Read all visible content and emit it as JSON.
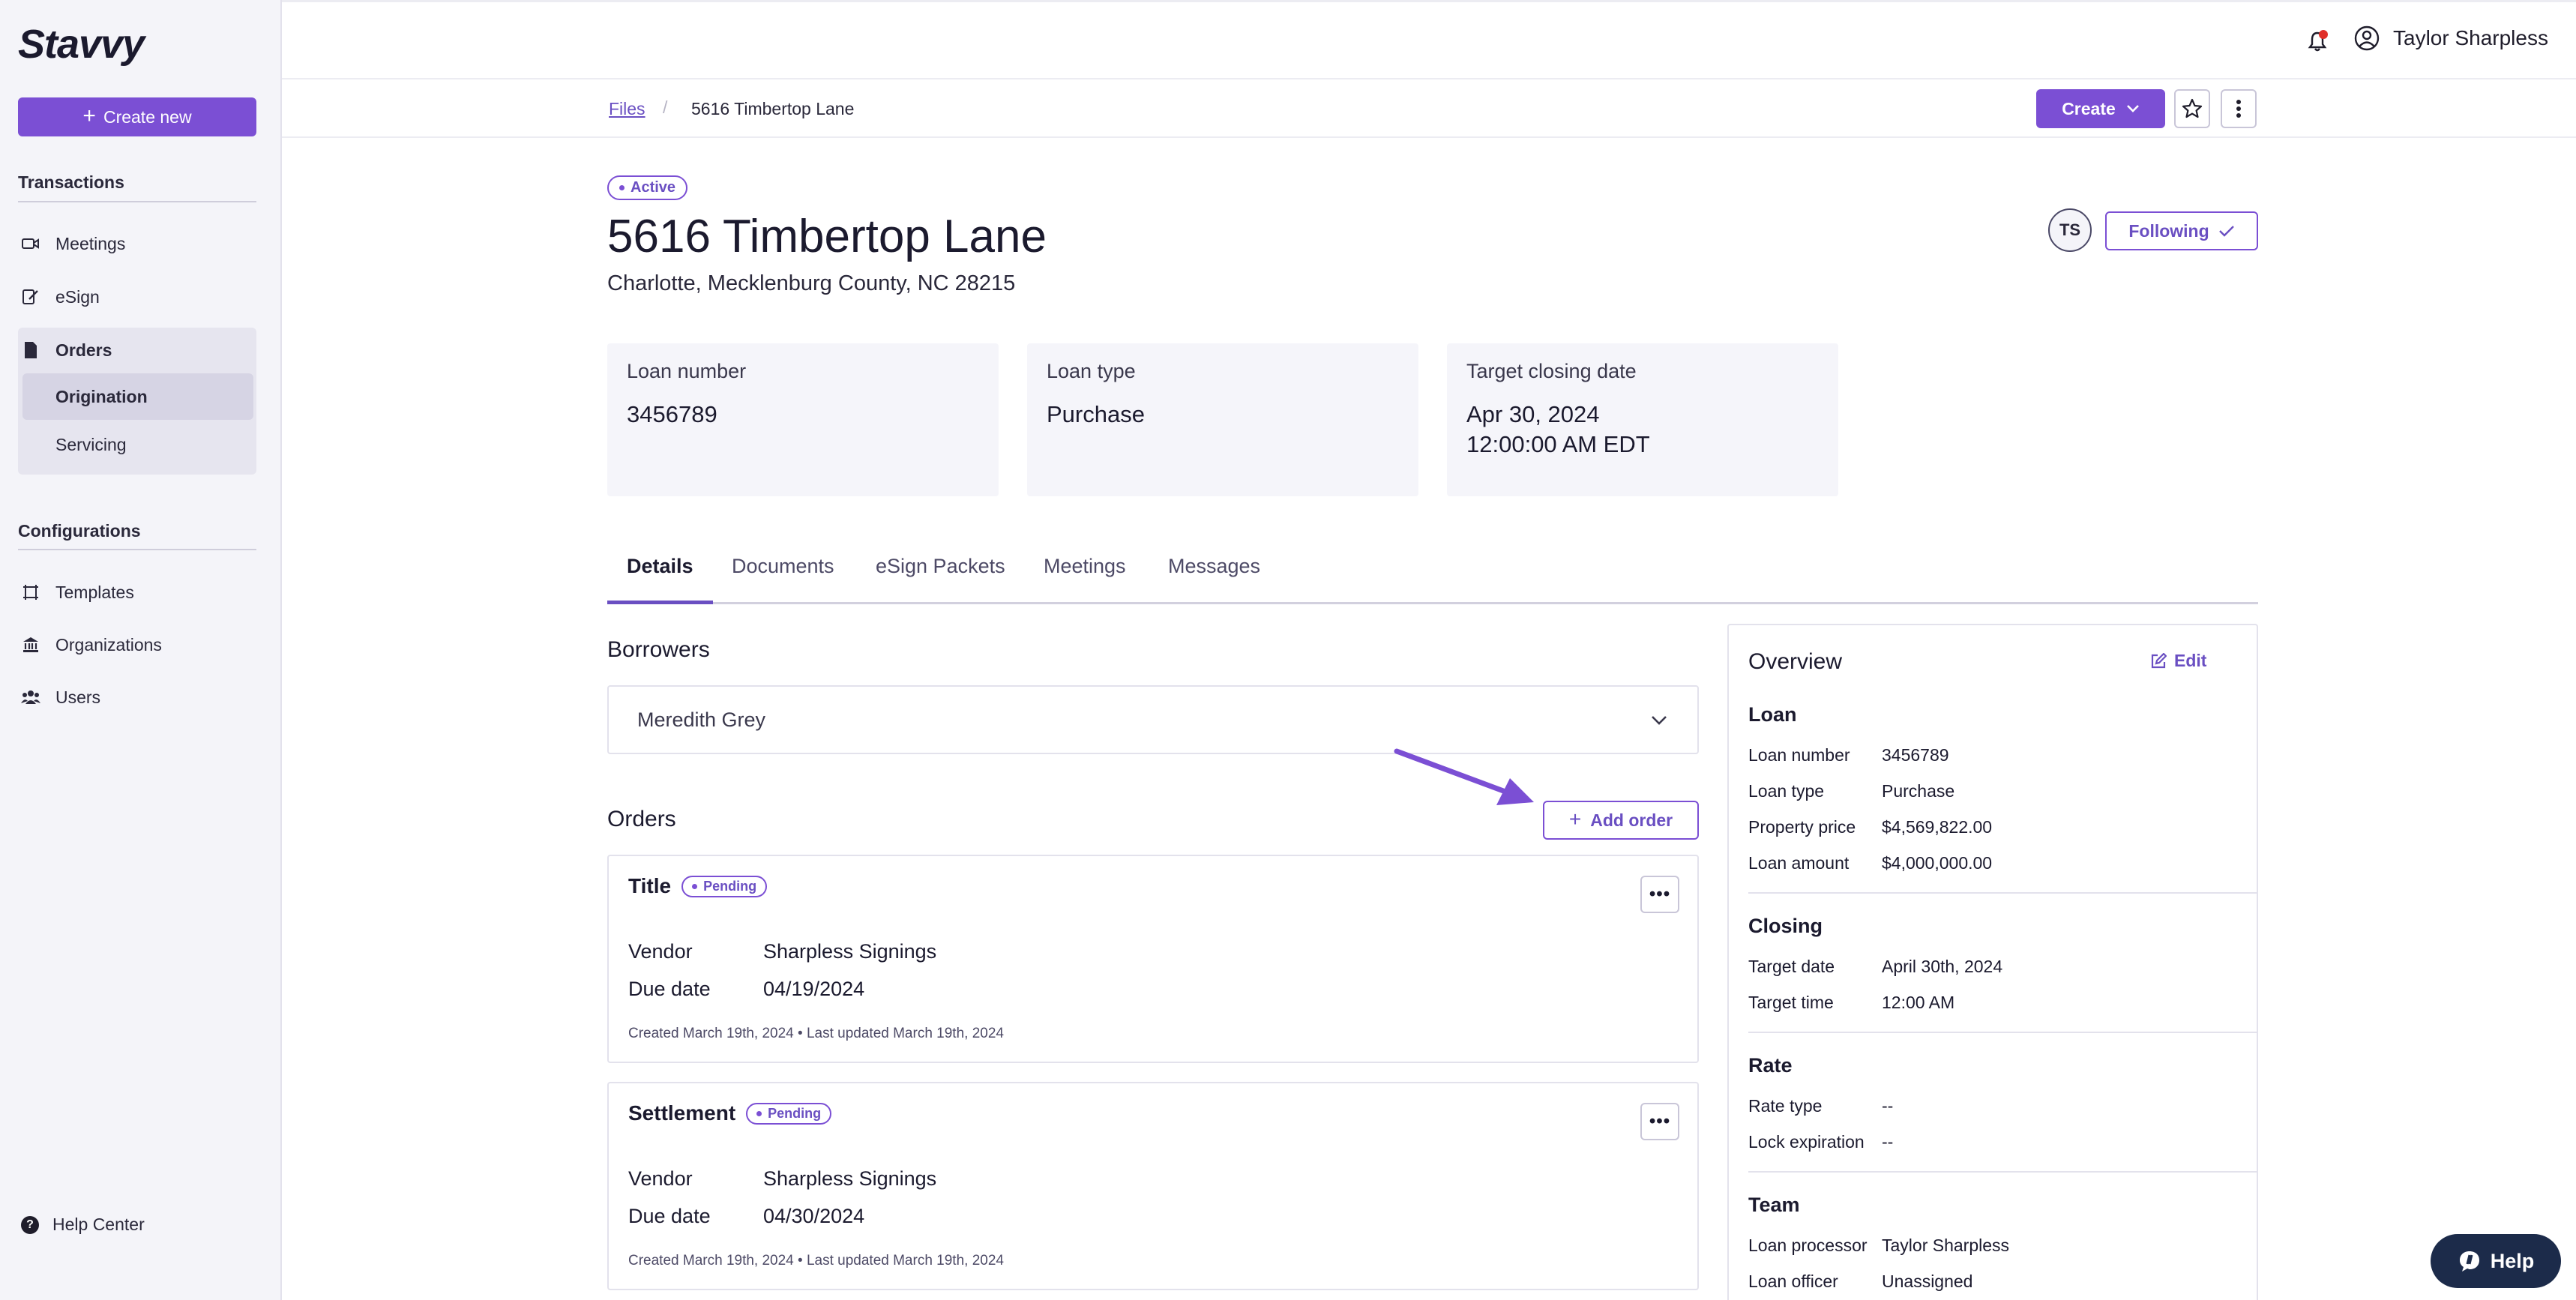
{
  "app": {
    "logo": "Stavvy"
  },
  "sidebar": {
    "create_new_label": "Create new",
    "transactions_title": "Transactions",
    "transactions": [
      {
        "label": "Meetings",
        "icon": "video-icon"
      },
      {
        "label": "eSign",
        "icon": "signature-icon"
      },
      {
        "label": "Orders",
        "icon": "document-icon"
      }
    ],
    "orders_sub": [
      {
        "label": "Origination",
        "active": true
      },
      {
        "label": "Servicing",
        "active": false
      }
    ],
    "configurations_title": "Configurations",
    "configurations": [
      {
        "label": "Templates",
        "icon": "template-icon"
      },
      {
        "label": "Organizations",
        "icon": "bank-icon"
      },
      {
        "label": "Users",
        "icon": "users-icon"
      }
    ],
    "help_center_label": "Help Center"
  },
  "header": {
    "user_name": "Taylor Sharpless",
    "notification_dot_color": "#e0302a"
  },
  "breadcrumb": {
    "root": "Files",
    "separator": "/",
    "current": "5616 Timbertop Lane"
  },
  "actions": {
    "create_label": "Create"
  },
  "file": {
    "status": "Active",
    "title": "5616 Timbertop Lane",
    "address": "Charlotte, Mecklenburg County, NC 28215",
    "assignee_initials": "TS",
    "following_label": "Following"
  },
  "cards": [
    {
      "label": "Loan number",
      "value": "3456789"
    },
    {
      "label": "Loan type",
      "value": "Purchase"
    },
    {
      "label": "Target closing date",
      "value": "Apr 30, 2024\n12:00:00 AM EDT"
    }
  ],
  "tabs": [
    {
      "label": "Details",
      "active": true
    },
    {
      "label": "Documents",
      "active": false
    },
    {
      "label": "eSign Packets",
      "active": false
    },
    {
      "label": "Meetings",
      "active": false
    },
    {
      "label": "Messages",
      "active": false
    }
  ],
  "borrowers": {
    "title": "Borrowers",
    "items": [
      "Meredith Grey"
    ]
  },
  "orders": {
    "title": "Orders",
    "add_label": "Add order",
    "items": [
      {
        "title": "Title",
        "status": "Pending",
        "vendor_label": "Vendor",
        "vendor": "Sharpless Signings",
        "due_label": "Due date",
        "due": "04/19/2024",
        "meta": "Created March 19th, 2024 • Last updated March 19th, 2024"
      },
      {
        "title": "Settlement",
        "status": "Pending",
        "vendor_label": "Vendor",
        "vendor": "Sharpless Signings",
        "due_label": "Due date",
        "due": "04/30/2024",
        "meta": "Created March 19th, 2024 • Last updated March 19th, 2024"
      }
    ]
  },
  "overview": {
    "title": "Overview",
    "edit_label": "Edit",
    "loan": {
      "title": "Loan",
      "rows": [
        {
          "k": "Loan number",
          "v": "3456789"
        },
        {
          "k": "Loan type",
          "v": "Purchase"
        },
        {
          "k": "Property price",
          "v": "$4,569,822.00"
        },
        {
          "k": "Loan amount",
          "v": "$4,000,000.00"
        }
      ]
    },
    "closing": {
      "title": "Closing",
      "rows": [
        {
          "k": "Target date",
          "v": "April 30th, 2024"
        },
        {
          "k": "Target time",
          "v": "12:00 AM"
        }
      ]
    },
    "rate": {
      "title": "Rate",
      "rows": [
        {
          "k": "Rate type",
          "v": "--"
        },
        {
          "k": "Lock expiration",
          "v": "--"
        }
      ]
    },
    "team": {
      "title": "Team",
      "rows": [
        {
          "k": "Loan processor",
          "v": "Taylor Sharpless"
        },
        {
          "k": "Loan officer",
          "v": "Unassigned"
        }
      ]
    }
  },
  "help_widget": {
    "label": "Help"
  },
  "colors": {
    "accent": "#7b4fd4",
    "help_widget": "#1c2b4a"
  }
}
